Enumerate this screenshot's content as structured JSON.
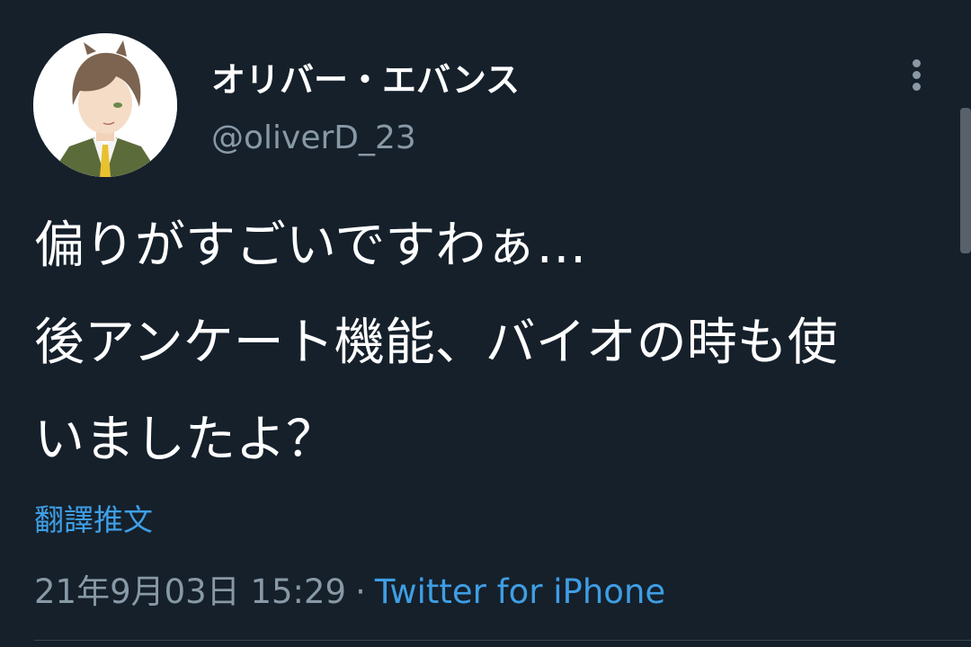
{
  "user": {
    "display_name": "オリバー・エバンス",
    "handle": "@oliverD_23",
    "avatar_icon": "anime-character-avatar-icon"
  },
  "tweet": {
    "lines": [
      "偏りがすごいですわぁ…",
      "後アンケート機能、バイオの時も使",
      "いましたよ？"
    ],
    "translate_label": "翻譯推文",
    "timestamp": "21年9月03日 15:29",
    "separator": "·",
    "source": "Twitter for iPhone"
  },
  "icons": {
    "more": "more-vertical-icon"
  },
  "colors": {
    "background": "#15202b",
    "primary_text": "#ffffff",
    "secondary_text": "#8899a6",
    "accent": "#3f9ee4",
    "divider": "#38444d"
  }
}
